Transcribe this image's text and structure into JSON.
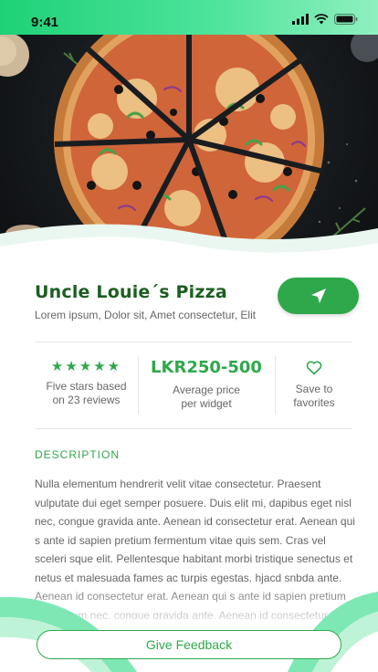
{
  "status_bar": {
    "time": "9:41"
  },
  "colors": {
    "accent": "#2ea84b",
    "title": "#1b5e20",
    "status_gradient_start": "#1ed177",
    "deco_light": "#7ee8b4"
  },
  "restaurant": {
    "name": "Uncle Louie´s Pizza",
    "tagline": "Lorem ipsum, Dolor sit, Amet consectetur, Elit"
  },
  "navigate_button": {
    "icon": "navigation-arrow-icon"
  },
  "stats": {
    "rating": {
      "stars": "★★★★★",
      "line1": "Five stars based",
      "line2": "on 23 reviews"
    },
    "price": {
      "value": "LKR250-500",
      "line1": "Average price",
      "line2": "per widget"
    },
    "favorite": {
      "icon": "heart-outline-icon",
      "line1": "Save to",
      "line2": "favorites"
    }
  },
  "description": {
    "heading": "DESCRIPTION",
    "body": "Nulla elementum hendrerit velit vitae consectetur.  Praesent vulputate dui eget semper posuere. Duis  elit mi, dapibus eget nisl  nec, congue gravida ante. Aenean id consectetur erat. Aenean qui s ante id sapien pretium fermentum vitae quis sem. Cras vel sceleri sque elit. Pellentesque habitant morbi tristique senectus et netus et  malesuada fames ac turpis egestas. hjacd snbda ante. Aenean id consectetur erat. Aenean qui s ante id sapien pretium fermentum nec, congue gravida ante. Aenean id consectetur erat. Aenea esdas"
  },
  "feedback_button": {
    "label": "Give Feedback"
  }
}
